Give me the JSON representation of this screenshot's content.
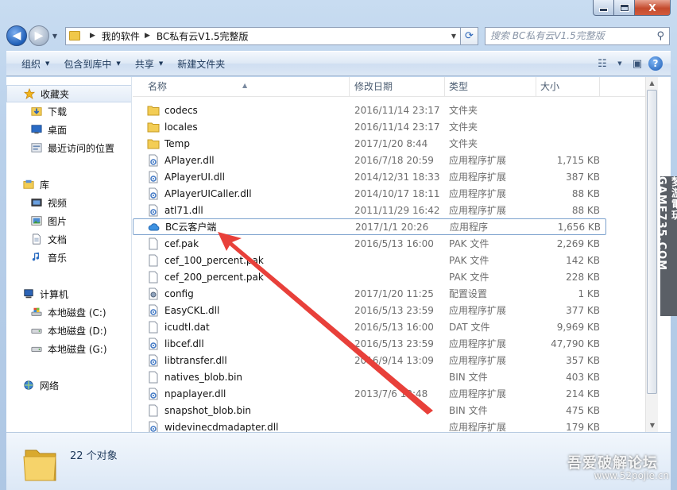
{
  "window": {
    "minimize_label": "—",
    "maximize_label": "□",
    "close_label": "X"
  },
  "address": {
    "crumbs": [
      "我的软件",
      "BC私有云V1.5完整版"
    ],
    "search_placeholder": "搜索 BC私有云V1.5完整版"
  },
  "toolbar": {
    "organize": "组织",
    "include_in_library": "包含到库中",
    "share": "共享",
    "new_folder": "新建文件夹"
  },
  "nav": {
    "favorites": "收藏夹",
    "downloads": "下载",
    "desktop": "桌面",
    "recent": "最近访问的位置",
    "libraries": "库",
    "videos": "视频",
    "pictures": "图片",
    "documents": "文档",
    "music": "音乐",
    "computer": "计算机",
    "drive_c": "本地磁盘 (C:)",
    "drive_d": "本地磁盘 (D:)",
    "drive_g": "本地磁盘 (G:)",
    "network": "网络"
  },
  "columns": {
    "name": "名称",
    "date": "修改日期",
    "type": "类型",
    "size": "大小"
  },
  "files": [
    {
      "name": "codecs",
      "date": "2016/11/14 23:17",
      "type": "文件夹",
      "size": "",
      "icon": "folder-icon"
    },
    {
      "name": "locales",
      "date": "2016/11/14 23:17",
      "type": "文件夹",
      "size": "",
      "icon": "folder-icon"
    },
    {
      "name": "Temp",
      "date": "2017/1/20 8:44",
      "type": "文件夹",
      "size": "",
      "icon": "folder-icon"
    },
    {
      "name": "APlayer.dll",
      "date": "2016/7/18 20:59",
      "type": "应用程序扩展",
      "size": "1,715 KB",
      "icon": "dll-icon"
    },
    {
      "name": "APlayerUI.dll",
      "date": "2014/12/31 18:33",
      "type": "应用程序扩展",
      "size": "387 KB",
      "icon": "dll-icon"
    },
    {
      "name": "APlayerUICaller.dll",
      "date": "2014/10/17 18:11",
      "type": "应用程序扩展",
      "size": "88 KB",
      "icon": "dll-icon"
    },
    {
      "name": "atl71.dll",
      "date": "2011/11/29 16:42",
      "type": "应用程序扩展",
      "size": "88 KB",
      "icon": "dll-icon"
    },
    {
      "name": "BC云客户端",
      "date": "2017/1/1 20:26",
      "type": "应用程序",
      "size": "1,656 KB",
      "icon": "cloud-app-icon"
    },
    {
      "name": "cef.pak",
      "date": "2016/5/13 16:00",
      "type": "PAK 文件",
      "size": "2,269 KB",
      "icon": "file-icon"
    },
    {
      "name": "cef_100_percent.pak",
      "date": "",
      "type": "PAK 文件",
      "size": "142 KB",
      "icon": "file-icon"
    },
    {
      "name": "cef_200_percent.pak",
      "date": "",
      "type": "PAK 文件",
      "size": "228 KB",
      "icon": "file-icon"
    },
    {
      "name": "config",
      "date": "2017/1/20 11:25",
      "type": "配置设置",
      "size": "1 KB",
      "icon": "config-icon"
    },
    {
      "name": "EasyCKL.dll",
      "date": "2016/5/13 23:59",
      "type": "应用程序扩展",
      "size": "377 KB",
      "icon": "dll-icon"
    },
    {
      "name": "icudtl.dat",
      "date": "2016/5/13 16:00",
      "type": "DAT 文件",
      "size": "9,969 KB",
      "icon": "file-icon"
    },
    {
      "name": "libcef.dll",
      "date": "2016/5/13 23:59",
      "type": "应用程序扩展",
      "size": "47,790 KB",
      "icon": "dll-icon"
    },
    {
      "name": "libtransfer.dll",
      "date": "2016/9/14 13:09",
      "type": "应用程序扩展",
      "size": "357 KB",
      "icon": "dll-icon"
    },
    {
      "name": "natives_blob.bin",
      "date": "",
      "type": "BIN 文件",
      "size": "403 KB",
      "icon": "file-icon"
    },
    {
      "name": "npaplayer.dll",
      "date": "2013/7/6 13:48",
      "type": "应用程序扩展",
      "size": "214 KB",
      "icon": "dll-icon"
    },
    {
      "name": "snapshot_blob.bin",
      "date": "",
      "type": "BIN 文件",
      "size": "475 KB",
      "icon": "file-icon"
    },
    {
      "name": "widevinecdmadapter.dll",
      "date": "",
      "type": "应用程序扩展",
      "size": "179 KB",
      "icon": "dll-icon"
    }
  ],
  "status": {
    "count": "22 个对象"
  },
  "watermarks": {
    "forum_name": "吾爱破解论坛",
    "forum_url": "www.52pojie.cn",
    "side": "梦游電玩 GAME735.COM"
  },
  "colors": {
    "selection_border": "#7da2ce",
    "arrow": "#e8403a"
  }
}
